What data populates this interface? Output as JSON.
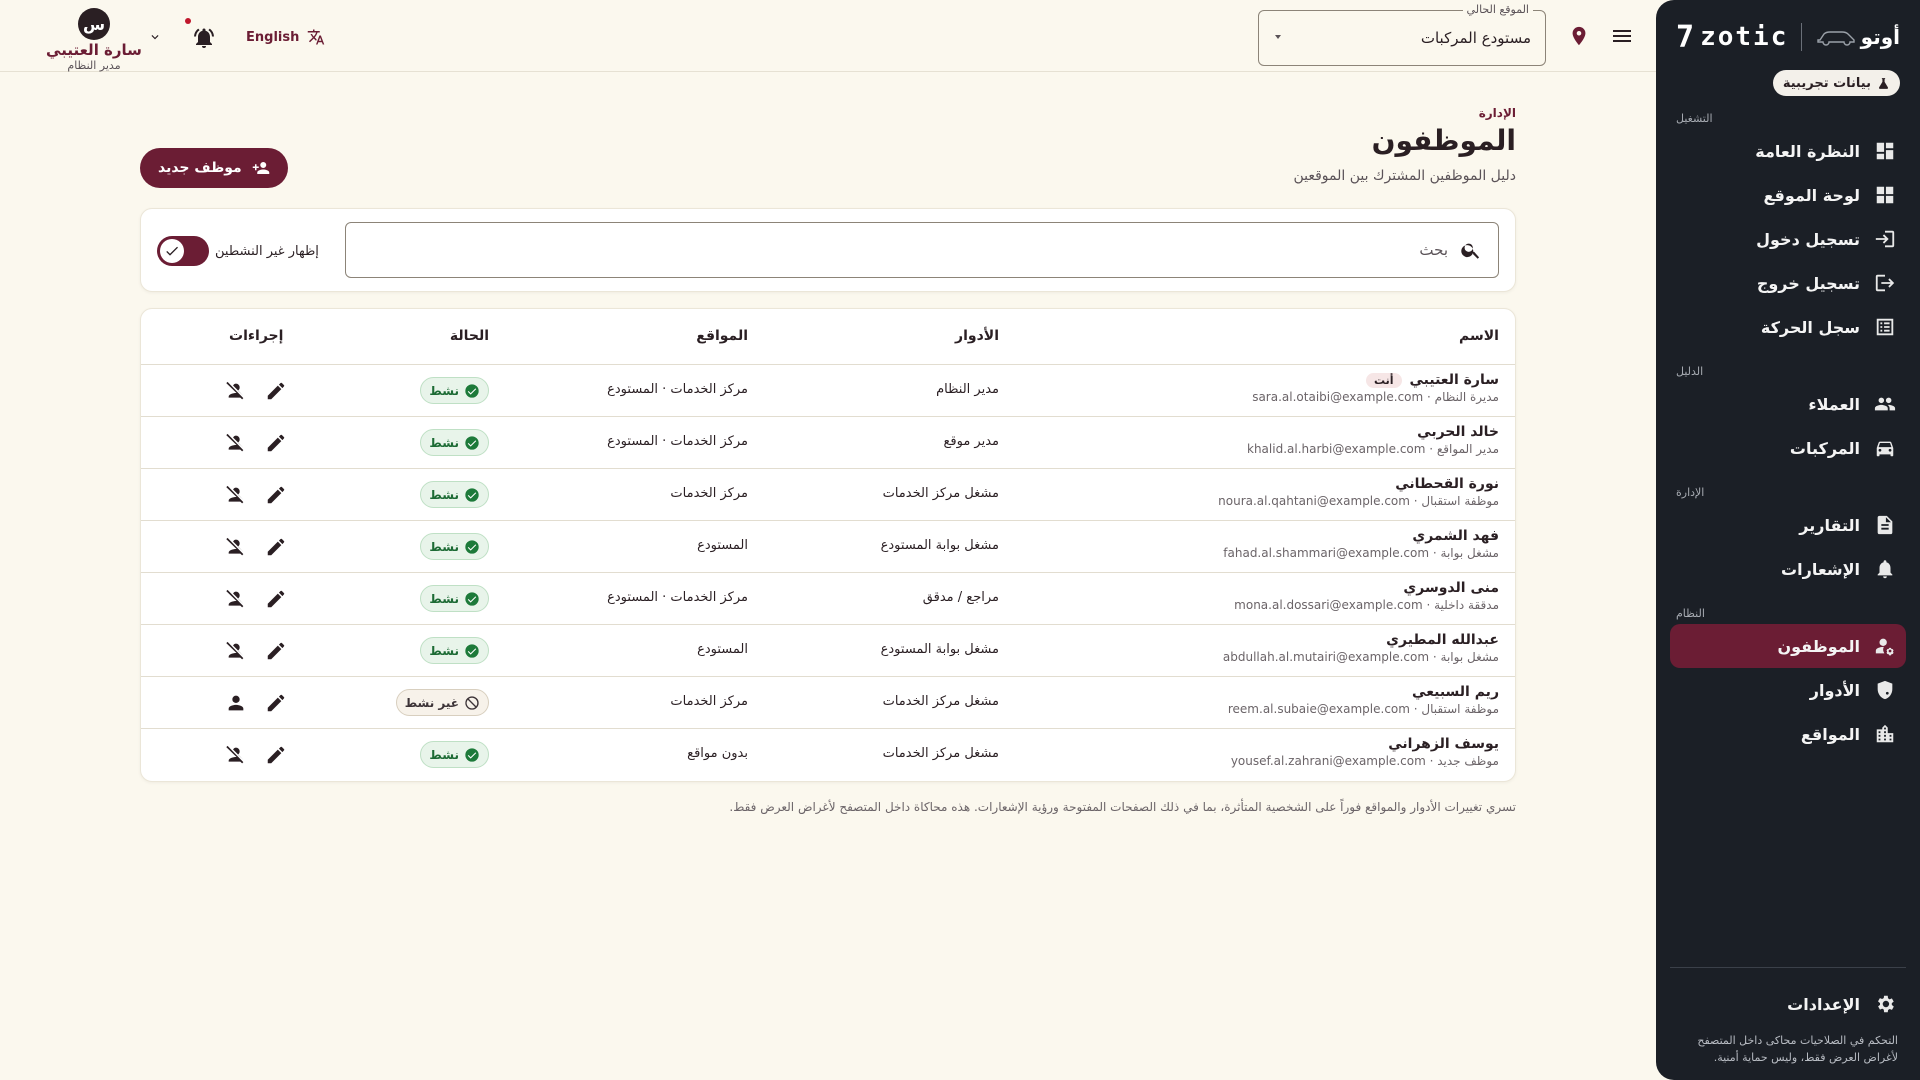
{
  "sidebar": {
    "app_name": "أوتو",
    "logo_text": "zotic",
    "demo_badge": "بيانات تجريبية",
    "sections": {
      "operation": "التشغيل",
      "directory": "الدليل",
      "administration": "الإدارة",
      "system": "النظام"
    },
    "items": {
      "overview": "النظرة العامة",
      "site_board": "لوحة الموقع",
      "check_in": "تسجيل دخول",
      "check_out": "تسجيل خروج",
      "movement_log": "سجل الحركة",
      "customers": "العملاء",
      "vehicles": "المركبات",
      "reports": "التقارير",
      "notifications": "الإشعارات",
      "employees": "الموظفون",
      "roles": "الأدوار",
      "sites": "المواقع"
    },
    "settings": "الإعدادات",
    "note": "التحكم في الصلاحيات محاكى داخل المتصفح لأغراض العرض فقط، وليس حماية أمنية."
  },
  "header": {
    "location_legend": "الموقع الحالي",
    "location_value": "مستودع المركبات",
    "language": "English",
    "user": {
      "initial": "س",
      "name": "سارة العتيبي",
      "role": "مدير النظام"
    }
  },
  "page": {
    "breadcrumb": "الإدارة",
    "title": "الموظفون",
    "subtitle": "دليل الموظفين المشترك بين الموقعين",
    "new_button": "موظف جديد",
    "search_placeholder": "بحث",
    "show_inactive_label": "إظهار غير النشطين",
    "show_inactive": true,
    "footnote": "تسري تغييرات الأدوار والمواقع فوراً على الشخصية المتأثرة، بما في ذلك الصفحات المفتوحة ورؤية الإشعارات. هذه محاكاة داخل المتصفح لأغراض العرض فقط."
  },
  "table": {
    "columns": {
      "name": "الاسم",
      "roles": "الأدوار",
      "sites": "المواقع",
      "status": "الحالة",
      "actions": "إجراءات"
    },
    "you_label": "أنت",
    "rows": [
      {
        "name": "سارة العتيبي",
        "you": true,
        "title": "مديرة النظام",
        "email": "sara.al.otaibi@example.com",
        "role": "مدير النظام",
        "sites": "مركز الخدمات · المستودع",
        "status": "نشط",
        "active": true
      },
      {
        "name": "خالد الحربي",
        "you": false,
        "title": "مدير المواقع",
        "email": "khalid.al.harbi@example.com",
        "role": "مدير موقع",
        "sites": "مركز الخدمات · المستودع",
        "status": "نشط",
        "active": true
      },
      {
        "name": "نورة القحطاني",
        "you": false,
        "title": "موظفة استقبال",
        "email": "noura.al.qahtani@example.com",
        "role": "مشغل مركز الخدمات",
        "sites": "مركز الخدمات",
        "status": "نشط",
        "active": true
      },
      {
        "name": "فهد الشمري",
        "you": false,
        "title": "مشغل بوابة",
        "email": "fahad.al.shammari@example.com",
        "role": "مشغل بوابة المستودع",
        "sites": "المستودع",
        "status": "نشط",
        "active": true
      },
      {
        "name": "منى الدوسري",
        "you": false,
        "title": "مدققة داخلية",
        "email": "mona.al.dossari@example.com",
        "role": "مراجع / مدقق",
        "sites": "مركز الخدمات · المستودع",
        "status": "نشط",
        "active": true
      },
      {
        "name": "عبدالله المطيري",
        "you": false,
        "title": "مشغل بوابة",
        "email": "abdullah.al.mutairi@example.com",
        "role": "مشغل بوابة المستودع",
        "sites": "المستودع",
        "status": "نشط",
        "active": true
      },
      {
        "name": "ريم السبيعي",
        "you": false,
        "title": "موظفة استقبال",
        "email": "reem.al.subaie@example.com",
        "role": "مشغل مركز الخدمات",
        "sites": "مركز الخدمات",
        "status": "غير نشط",
        "active": false
      },
      {
        "name": "يوسف الزهراني",
        "you": false,
        "title": "موظف جديد",
        "email": "yousef.al.zahrani@example.com",
        "role": "مشغل مركز الخدمات",
        "sites": "بدون مواقع",
        "status": "نشط",
        "active": true
      }
    ]
  }
}
